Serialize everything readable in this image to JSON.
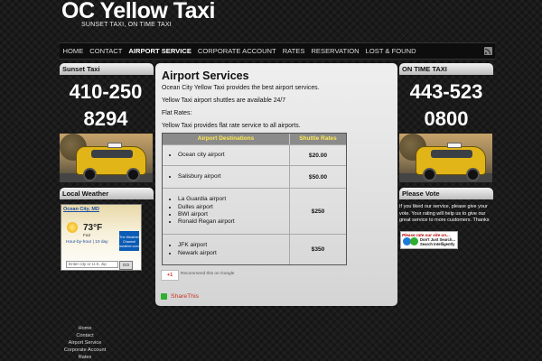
{
  "site": {
    "title": "OC Yellow Taxi",
    "tagline": "SUNSET TAXI, ON TIME TAXI"
  },
  "nav": {
    "items": [
      "HOME",
      "CONTACT",
      "AIRPORT SERVICE",
      "CORPORATE ACCOUNT",
      "RATES",
      "RESERVATION",
      "LOST & FOUND"
    ],
    "active": "AIRPORT SERVICE",
    "rss_icon": "rss-icon"
  },
  "left": {
    "sunset_title": "Sunset Taxi",
    "phone_line1": "410-250",
    "phone_line2": "8294",
    "weather_title": "Local Weather",
    "weather": {
      "city": "Ocean City, MD",
      "temp": "73°F",
      "condition": "Fair",
      "links": "Hour-by-hour | 10 day",
      "provider": "The Weather Channel weather.com",
      "input_placeholder": "Enter city or U.S. zip",
      "go_label": "GO"
    }
  },
  "main": {
    "title": "Airport Services",
    "p1": "Ocean City Yellow Taxi provides the best airport services.",
    "p2": "Yellow Taxi airport shuttles are available 24/7",
    "p3": "Flat Rates:",
    "p4": "Yellow  Taxi provides flat rate service to all airports.",
    "table": {
      "headers": [
        "Airport Destinations",
        "Shuttle Rates"
      ],
      "rows": [
        {
          "destinations": [
            "Ocean city airport"
          ],
          "rate": "$20.00"
        },
        {
          "destinations": [
            "Salisbury airport"
          ],
          "rate": "$50.00"
        },
        {
          "destinations": [
            "La Guardia airport",
            "Dulles airport",
            "BWI airport",
            "Ronald Regan airport"
          ],
          "rate": "$250"
        },
        {
          "destinations": [
            "JFK airport",
            "Newark airport"
          ],
          "rate": "$350"
        }
      ]
    },
    "plusone": "+1",
    "recommend": "Recommend this on Google",
    "share": "ShareThis"
  },
  "right": {
    "ontime_title": "ON TIME TAXI",
    "phone_line1": "443-523",
    "phone_line2": "0800",
    "vote_title": "Please Vote",
    "vote_text": "If you liked our service, please give your vote. Your rating will help us to give our great service to more customers. Thanks",
    "vote_badge_line1": "Please rate our site on...",
    "vote_badge_line2": "Don't Just Search... Search Intelligently"
  },
  "footer": {
    "links": [
      "Home",
      "Contact",
      "Airport Service",
      "Corporate Account",
      "Rates"
    ]
  }
}
